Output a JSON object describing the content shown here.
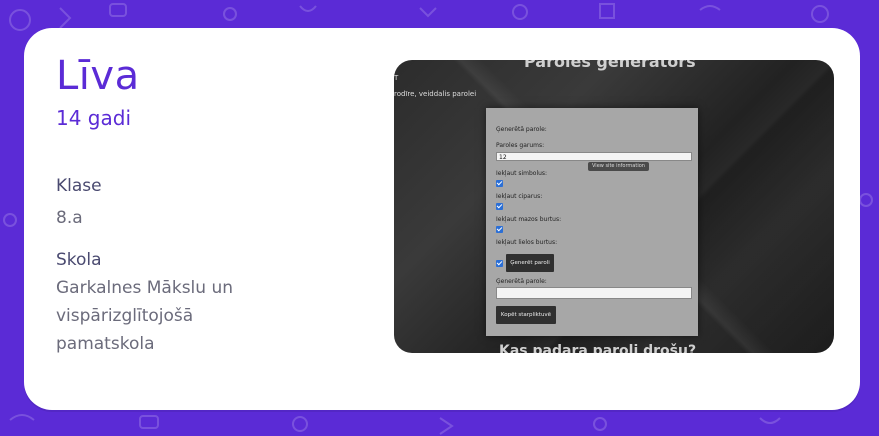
{
  "profile": {
    "name": "Līva",
    "age": "14 gadi",
    "class_label": "Klase",
    "class_value": "8.a",
    "school_label": "Skola",
    "school_lines": [
      "Garkalnes Mākslu un",
      "vispārizglītojošā",
      "pamatskola"
    ]
  },
  "screenshot": {
    "title": "Paroles ģenerators",
    "side_letter": "T",
    "side_hint": "rodīre, veiddalis parolei",
    "panel": {
      "generated_label": "Ģenerētā parole:",
      "length_label": "Paroles garums:",
      "length_value": "12",
      "tooltip": "View site information",
      "opt_symbols": "Iekļaut simbolus:",
      "opt_numbers": "Iekļaut ciparus:",
      "opt_upper": "Iekļaut mazos burtus:",
      "opt_lower": "Iekļaut lielos burtus:",
      "generate_button": "Ģenerēt paroli",
      "generated_password_label": "Ģenerētā parole:",
      "copy_button": "Kopēt starpliktuvē"
    },
    "bottom_title": "Kas padara paroli drošu?"
  },
  "colors": {
    "accent": "#5b2bd6",
    "card": "#ffffff"
  }
}
